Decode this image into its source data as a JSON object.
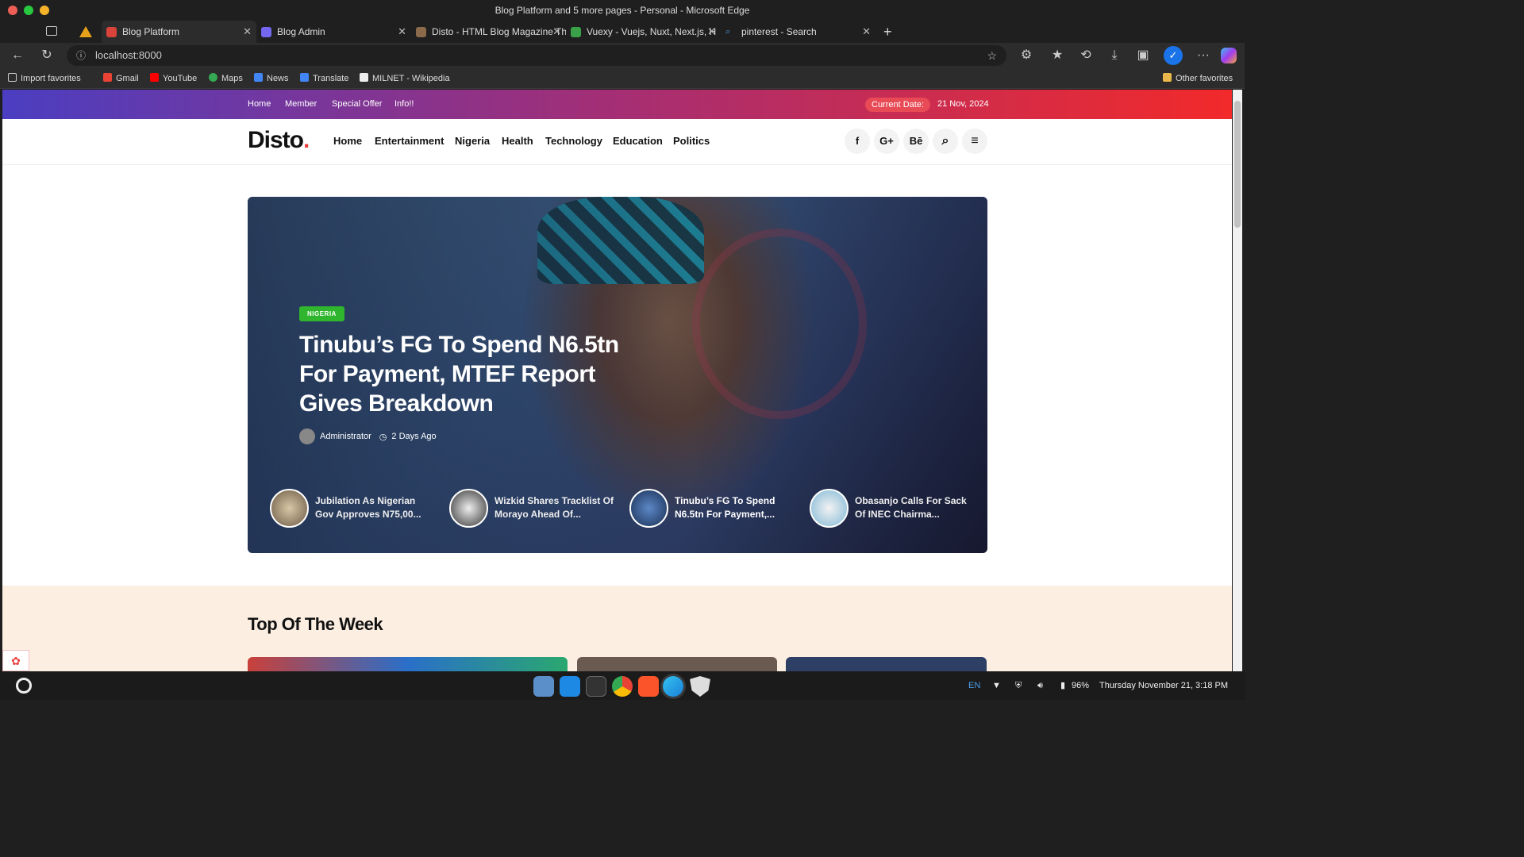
{
  "browser": {
    "window_title": "Blog Platform and 5 more pages - Personal - Microsoft Edge",
    "tabs": [
      {
        "label": "Blog Platform"
      },
      {
        "label": "Blog Admin"
      },
      {
        "label": "Disto - HTML Blog Magazine Th"
      },
      {
        "label": "Vuexy - Vuejs, Nuxt, Next.js, H"
      },
      {
        "label": "pinterest - Search"
      }
    ],
    "url": "localhost:8000",
    "bookmarks": [
      "Import favorites",
      "Gmail",
      "YouTube",
      "Maps",
      "News",
      "Translate",
      "MILNET - Wikipedia"
    ],
    "other_favorites": "Other favorites"
  },
  "site": {
    "topnav": [
      "Home",
      "Member",
      "Special Offer",
      "Info!!"
    ],
    "current_date_label": "Current Date:",
    "current_date": "21 Nov, 2024",
    "logo": "Disto",
    "logo_dot": ".",
    "menu": [
      "Home",
      "Entertainment",
      "Nigeria",
      "Health",
      "Technology",
      "Education",
      "Politics"
    ],
    "social": {
      "facebook": "f",
      "google": "G+",
      "behance": "Bē",
      "search": "⌕",
      "menu": "≡"
    },
    "hero": {
      "category": "NIGERIA",
      "title": "Tinubu’s FG To Spend N6.5tn For Payment, MTEF Report Gives Breakdown",
      "author": "Administrator",
      "time": "2 Days Ago",
      "minis": [
        "Jubilation As Nigerian Gov Approves N75,00...",
        "Wizkid Shares Tracklist Of Morayo Ahead Of...",
        "Tinubu’s FG To Spend N6.5tn For Payment,...",
        "Obasanjo Calls For Sack Of INEC Chairma..."
      ]
    },
    "section_title": "Top Of The Week"
  },
  "taskbar": {
    "lang": "EN",
    "battery": "96%",
    "datetime": "Thursday November 21, 3:18 PM"
  }
}
